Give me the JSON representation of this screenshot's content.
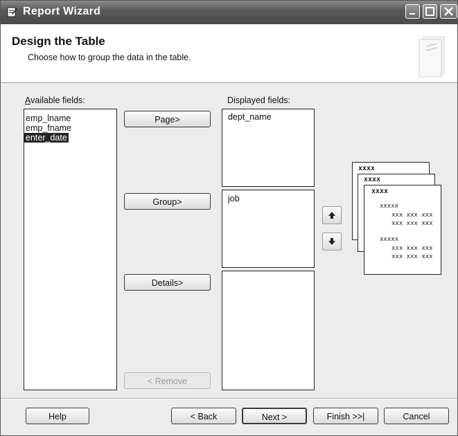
{
  "window": {
    "title": "Report Wizard"
  },
  "header": {
    "title": "Design the Table",
    "subtitle": "Choose how to group the data in the table."
  },
  "available": {
    "label": "Available fields:",
    "items": [
      "emp_lname",
      "emp_fname",
      "enter_date"
    ],
    "selected_index": 2
  },
  "displayed": {
    "label": "Displayed fields:",
    "page_items": [
      "dept_name"
    ],
    "group_items": [
      "job"
    ],
    "details_items": []
  },
  "buttons": {
    "page": "Page>",
    "group": "Group>",
    "details": "Details>",
    "remove": "< Remove",
    "help": "Help",
    "back": "< Back",
    "next": "Next >",
    "finish": "Finish >>|",
    "cancel": "Cancel"
  },
  "icons": {
    "app": "report-wizard-icon",
    "move_up": "arrow-up-icon",
    "move_down": "arrow-down-icon",
    "header": "document-stack-icon"
  },
  "preview": {
    "card_header": "xxxx",
    "group_header": "xxxxx",
    "detail_row": "xxx xxx xxx"
  }
}
